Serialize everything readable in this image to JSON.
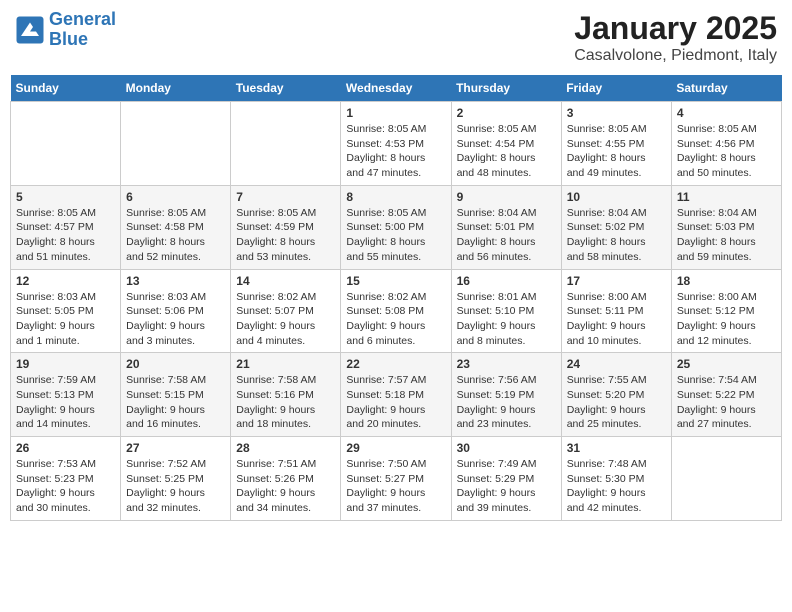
{
  "logo": {
    "line1": "General",
    "line2": "Blue"
  },
  "title": "January 2025",
  "subtitle": "Casalvolone, Piedmont, Italy",
  "weekdays": [
    "Sunday",
    "Monday",
    "Tuesday",
    "Wednesday",
    "Thursday",
    "Friday",
    "Saturday"
  ],
  "weeks": [
    [
      {
        "day": "",
        "info": ""
      },
      {
        "day": "",
        "info": ""
      },
      {
        "day": "",
        "info": ""
      },
      {
        "day": "1",
        "info": "Sunrise: 8:05 AM\nSunset: 4:53 PM\nDaylight: 8 hours and 47 minutes."
      },
      {
        "day": "2",
        "info": "Sunrise: 8:05 AM\nSunset: 4:54 PM\nDaylight: 8 hours and 48 minutes."
      },
      {
        "day": "3",
        "info": "Sunrise: 8:05 AM\nSunset: 4:55 PM\nDaylight: 8 hours and 49 minutes."
      },
      {
        "day": "4",
        "info": "Sunrise: 8:05 AM\nSunset: 4:56 PM\nDaylight: 8 hours and 50 minutes."
      }
    ],
    [
      {
        "day": "5",
        "info": "Sunrise: 8:05 AM\nSunset: 4:57 PM\nDaylight: 8 hours and 51 minutes."
      },
      {
        "day": "6",
        "info": "Sunrise: 8:05 AM\nSunset: 4:58 PM\nDaylight: 8 hours and 52 minutes."
      },
      {
        "day": "7",
        "info": "Sunrise: 8:05 AM\nSunset: 4:59 PM\nDaylight: 8 hours and 53 minutes."
      },
      {
        "day": "8",
        "info": "Sunrise: 8:05 AM\nSunset: 5:00 PM\nDaylight: 8 hours and 55 minutes."
      },
      {
        "day": "9",
        "info": "Sunrise: 8:04 AM\nSunset: 5:01 PM\nDaylight: 8 hours and 56 minutes."
      },
      {
        "day": "10",
        "info": "Sunrise: 8:04 AM\nSunset: 5:02 PM\nDaylight: 8 hours and 58 minutes."
      },
      {
        "day": "11",
        "info": "Sunrise: 8:04 AM\nSunset: 5:03 PM\nDaylight: 8 hours and 59 minutes."
      }
    ],
    [
      {
        "day": "12",
        "info": "Sunrise: 8:03 AM\nSunset: 5:05 PM\nDaylight: 9 hours and 1 minute."
      },
      {
        "day": "13",
        "info": "Sunrise: 8:03 AM\nSunset: 5:06 PM\nDaylight: 9 hours and 3 minutes."
      },
      {
        "day": "14",
        "info": "Sunrise: 8:02 AM\nSunset: 5:07 PM\nDaylight: 9 hours and 4 minutes."
      },
      {
        "day": "15",
        "info": "Sunrise: 8:02 AM\nSunset: 5:08 PM\nDaylight: 9 hours and 6 minutes."
      },
      {
        "day": "16",
        "info": "Sunrise: 8:01 AM\nSunset: 5:10 PM\nDaylight: 9 hours and 8 minutes."
      },
      {
        "day": "17",
        "info": "Sunrise: 8:00 AM\nSunset: 5:11 PM\nDaylight: 9 hours and 10 minutes."
      },
      {
        "day": "18",
        "info": "Sunrise: 8:00 AM\nSunset: 5:12 PM\nDaylight: 9 hours and 12 minutes."
      }
    ],
    [
      {
        "day": "19",
        "info": "Sunrise: 7:59 AM\nSunset: 5:13 PM\nDaylight: 9 hours and 14 minutes."
      },
      {
        "day": "20",
        "info": "Sunrise: 7:58 AM\nSunset: 5:15 PM\nDaylight: 9 hours and 16 minutes."
      },
      {
        "day": "21",
        "info": "Sunrise: 7:58 AM\nSunset: 5:16 PM\nDaylight: 9 hours and 18 minutes."
      },
      {
        "day": "22",
        "info": "Sunrise: 7:57 AM\nSunset: 5:18 PM\nDaylight: 9 hours and 20 minutes."
      },
      {
        "day": "23",
        "info": "Sunrise: 7:56 AM\nSunset: 5:19 PM\nDaylight: 9 hours and 23 minutes."
      },
      {
        "day": "24",
        "info": "Sunrise: 7:55 AM\nSunset: 5:20 PM\nDaylight: 9 hours and 25 minutes."
      },
      {
        "day": "25",
        "info": "Sunrise: 7:54 AM\nSunset: 5:22 PM\nDaylight: 9 hours and 27 minutes."
      }
    ],
    [
      {
        "day": "26",
        "info": "Sunrise: 7:53 AM\nSunset: 5:23 PM\nDaylight: 9 hours and 30 minutes."
      },
      {
        "day": "27",
        "info": "Sunrise: 7:52 AM\nSunset: 5:25 PM\nDaylight: 9 hours and 32 minutes."
      },
      {
        "day": "28",
        "info": "Sunrise: 7:51 AM\nSunset: 5:26 PM\nDaylight: 9 hours and 34 minutes."
      },
      {
        "day": "29",
        "info": "Sunrise: 7:50 AM\nSunset: 5:27 PM\nDaylight: 9 hours and 37 minutes."
      },
      {
        "day": "30",
        "info": "Sunrise: 7:49 AM\nSunset: 5:29 PM\nDaylight: 9 hours and 39 minutes."
      },
      {
        "day": "31",
        "info": "Sunrise: 7:48 AM\nSunset: 5:30 PM\nDaylight: 9 hours and 42 minutes."
      },
      {
        "day": "",
        "info": ""
      }
    ]
  ]
}
